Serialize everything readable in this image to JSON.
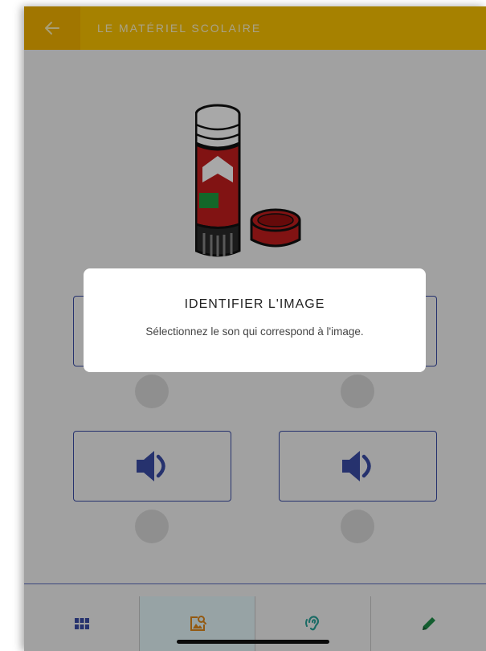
{
  "header": {
    "title": "LE MATÉRIEL SCOLAIRE",
    "back_icon": "arrow-left-icon",
    "background": "#fcc400"
  },
  "quiz": {
    "picture": "glue-stick-illustration",
    "options": [
      {
        "icon": "speaker-icon"
      },
      {
        "icon": "speaker-icon"
      },
      {
        "icon": "speaker-icon"
      },
      {
        "icon": "speaker-icon"
      }
    ],
    "accent": "#3a4da8"
  },
  "dialog": {
    "title": "IDENTIFIER L'IMAGE",
    "message": "Sélectionnez le son qui correspond à l'image."
  },
  "tabbar": {
    "tabs": [
      {
        "icon": "grid-icon",
        "active": false
      },
      {
        "icon": "image-search-icon",
        "active": true
      },
      {
        "icon": "ear-icon",
        "active": false
      },
      {
        "icon": "pencil-icon",
        "active": false
      }
    ]
  }
}
